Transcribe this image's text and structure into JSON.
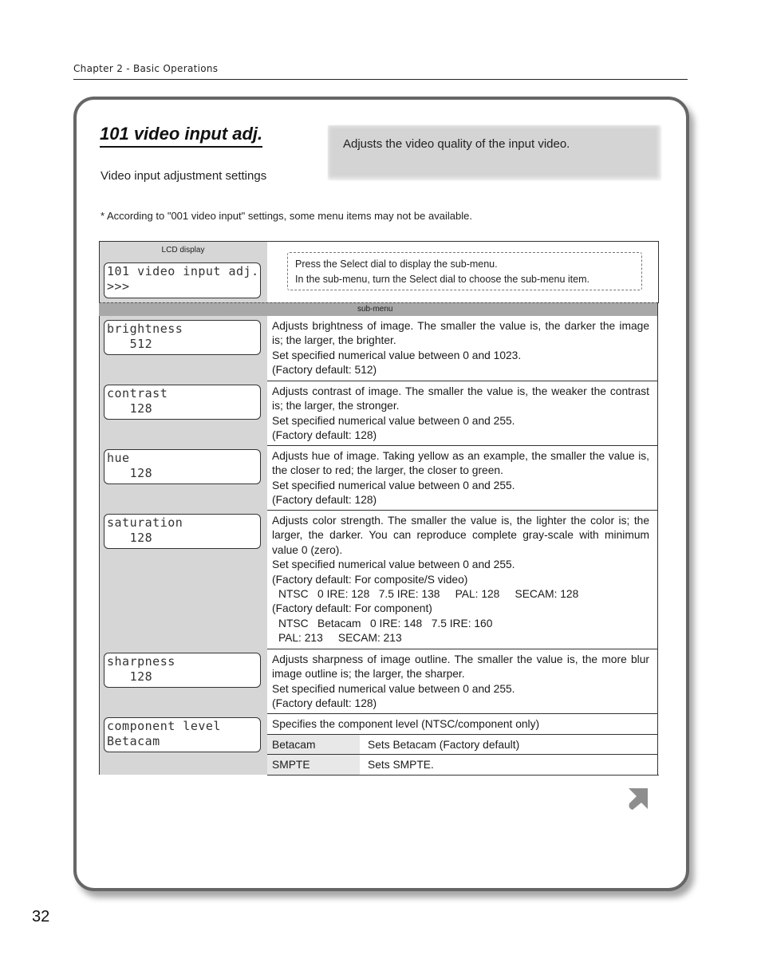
{
  "header": {
    "chapter": "Chapter 2 - Basic Operations"
  },
  "section": {
    "title": "101 video input adj.",
    "subtitle": "Video input adjustment settings",
    "summary": "Adjusts the video quality of the input video.",
    "note": "* According to \"001 video input\" settings, some menu items may not be available."
  },
  "table": {
    "lcd_label": "LCD display",
    "top_lcd": {
      "line1": "101 video input adj.",
      "line2": ">>>"
    },
    "instructions": [
      "Press the Select dial to display the sub-menu.",
      "In the sub-menu, turn the Select dial to choose the sub-menu item."
    ],
    "submenu_label": "sub-menu",
    "items": [
      {
        "lcd_line1": "brightness",
        "lcd_line2": "   512",
        "desc": [
          "Adjusts brightness of image. The smaller the value is, the darker the image is; the larger, the brighter.",
          "Set specified numerical value between 0 and 1023.",
          "(Factory default: 512)"
        ]
      },
      {
        "lcd_line1": "contrast",
        "lcd_line2": "   128",
        "desc": [
          "Adjusts contrast of image. The smaller the value is, the weaker the contrast is; the larger, the stronger.",
          "Set specified numerical value between 0 and 255.",
          "(Factory default: 128)"
        ]
      },
      {
        "lcd_line1": "hue",
        "lcd_line2": "   128",
        "desc": [
          "Adjusts hue of image. Taking yellow as an example, the smaller the value is, the closer to red; the larger, the closer to green.",
          "Set specified numerical value between 0 and 255.",
          "(Factory default: 128)"
        ]
      },
      {
        "lcd_line1": "saturation",
        "lcd_line2": "   128",
        "desc": [
          "Adjusts color strength. The smaller the value is, the lighter the color is; the larger, the darker. You can reproduce complete gray-scale with minimum value 0 (zero).",
          "Set specified numerical value between 0 and 255.",
          "(Factory default: For composite/S video)",
          "NTSC   0 IRE: 128   7.5 IRE: 138     PAL: 128     SECAM: 128",
          "(Factory default: For component)",
          "NTSC   Betacam   0 IRE: 148   7.5 IRE: 160",
          "PAL: 213     SECAM: 213"
        ]
      },
      {
        "lcd_line1": "sharpness",
        "lcd_line2": "   128",
        "desc": [
          "Adjusts sharpness of image outline. The smaller the value is, the more blur image outline is; the larger, the sharper.",
          "Set specified numerical value between 0 and 255.",
          "(Factory default: 128)"
        ]
      },
      {
        "lcd_line1": "component level",
        "lcd_line2": "Betacam",
        "desc": [
          "Specifies the component level (NTSC/component only)"
        ],
        "options": [
          {
            "key": "Betacam",
            "value": "Sets Betacam (Factory default)"
          },
          {
            "key": "SMPTE",
            "value": "Sets SMPTE."
          }
        ]
      }
    ]
  },
  "footer": {
    "page_number": "32",
    "next_icon": "continue-arrow-icon"
  }
}
